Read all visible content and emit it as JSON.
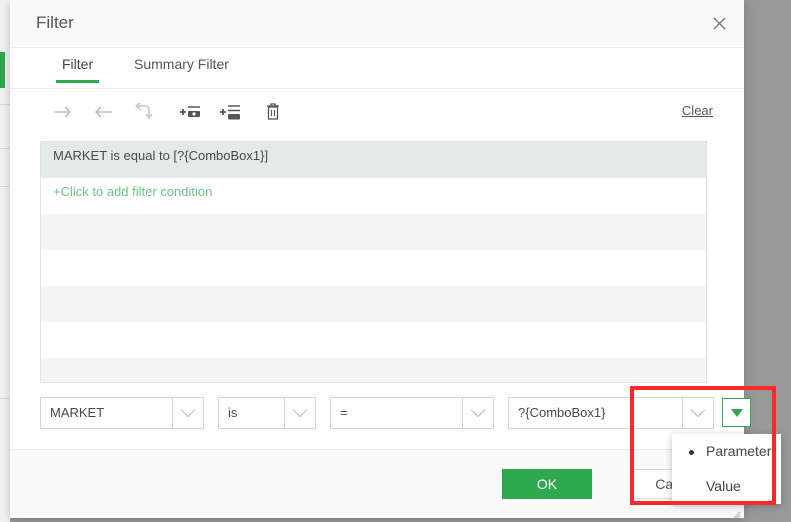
{
  "window": {
    "title": "Filter",
    "close_icon": "close-icon"
  },
  "tabs": [
    {
      "label": "Filter",
      "active": true
    },
    {
      "label": "Summary Filter",
      "active": false
    }
  ],
  "toolbar": {
    "icons": [
      {
        "name": "arrow-right-icon",
        "title": "Move right"
      },
      {
        "name": "arrow-left-icon",
        "title": "Move left"
      },
      {
        "name": "undo-arrow-icon",
        "title": "Undo"
      },
      {
        "name": "add-condition-icon",
        "title": "Add condition"
      },
      {
        "name": "add-group-icon",
        "title": "Add group"
      },
      {
        "name": "trash-icon",
        "title": "Delete"
      }
    ],
    "clear_label": "Clear"
  },
  "conditions": {
    "rows": [
      {
        "text": "MARKET is equal to [?{ComboBox1}]",
        "state": "selected"
      },
      {
        "text": "+Click to add filter condition",
        "state": "add"
      }
    ],
    "empty_rows": 6
  },
  "editor": {
    "field": {
      "value": "MARKET",
      "chevron": "chevron-down-icon"
    },
    "is": {
      "value": "is",
      "chevron": "chevron-down-icon"
    },
    "operator": {
      "value": "=",
      "chevron": "chevron-down-icon"
    },
    "value": {
      "value": "?{ComboBox1}",
      "chevron": "chevron-down-icon"
    },
    "param_button": {
      "icon": "triangle-down-icon"
    }
  },
  "popup": {
    "items": [
      {
        "label": "Parameter",
        "selected": true
      },
      {
        "label": "Value",
        "selected": false
      }
    ]
  },
  "footer": {
    "ok_label": "OK",
    "cancel_label": "Cancel",
    "grip": "resize-grip-icon"
  },
  "colors": {
    "accent_green": "#2fa84f",
    "highlight_red": "#fa2a2a",
    "selected_row": "#e4eae8",
    "stripe": "#f5f5f5"
  }
}
